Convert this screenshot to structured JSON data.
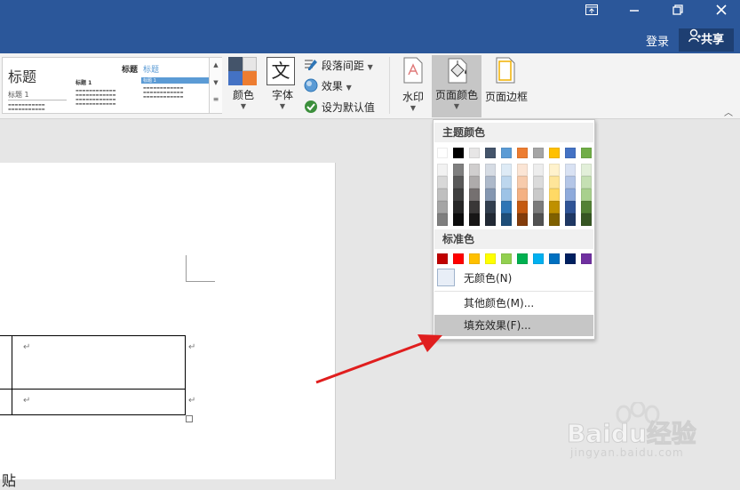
{
  "titlebar": {
    "buttons": [
      "ribbon-display-icon",
      "minimize-icon",
      "restore-icon",
      "close-icon"
    ],
    "login": "登录",
    "share": "共享"
  },
  "ribbon": {
    "gallery": {
      "items": [
        {
          "title": "标题",
          "heading": "标题 1"
        },
        {
          "title": "标题",
          "heading": "标题 1"
        },
        {
          "title": "标题",
          "heading": "标题 1"
        }
      ]
    },
    "colors": "颜色",
    "fonts": "字体",
    "font_glyph": "文",
    "paragraph_spacing": "段落间距",
    "effects": "效果",
    "set_default": "设为默认值",
    "watermark": "水印",
    "page_color": "页面颜色",
    "page_borders": "页面边框"
  },
  "document": {
    "cut_text": "贴"
  },
  "dropdown": {
    "theme_colors_header": "主题颜色",
    "theme_top_row": [
      "#ffffff",
      "#000000",
      "#e7e6e6",
      "#44546a",
      "#5b9bd5",
      "#ed7d31",
      "#a5a5a5",
      "#ffc000",
      "#4472c4",
      "#70ad47"
    ],
    "theme_shades": [
      [
        "#f2f2f2",
        "#7f7f7f",
        "#d0cece",
        "#d6dce4",
        "#deebf6",
        "#fbe5d5",
        "#ededed",
        "#fff2cc",
        "#d9e2f3",
        "#e2efd9"
      ],
      [
        "#d8d8d8",
        "#595959",
        "#aeabab",
        "#adb9ca",
        "#bdd7ee",
        "#f7cbac",
        "#dbdbdb",
        "#fee599",
        "#b4c6e7",
        "#c5e0b3"
      ],
      [
        "#bfbfbf",
        "#3f3f3f",
        "#757070",
        "#8496b0",
        "#9dc3e6",
        "#f4b183",
        "#c9c9c9",
        "#ffd965",
        "#8eaadb",
        "#a8d08d"
      ],
      [
        "#a5a5a5",
        "#262626",
        "#3a3838",
        "#323f4f",
        "#2e75b5",
        "#c55a11",
        "#7b7b7b",
        "#bf9000",
        "#2f5496",
        "#538135"
      ],
      [
        "#7f7f7f",
        "#0c0c0c",
        "#171616",
        "#222a35",
        "#1e4e79",
        "#833c0b",
        "#525252",
        "#7f6000",
        "#1f3864",
        "#375623"
      ]
    ],
    "standard_colors_header": "标准色",
    "standard_colors": [
      "#c00000",
      "#ff0000",
      "#ffc000",
      "#ffff00",
      "#92d050",
      "#00b050",
      "#00b0f0",
      "#0070c0",
      "#002060",
      "#7030a0"
    ],
    "no_color": "无颜色(N)",
    "more_colors": "其他颜色(M)...",
    "fill_effects": "填充效果(F)..."
  },
  "watermark": {
    "brand": "Baidu经验",
    "url": "jingyan.baidu.com"
  },
  "colors": {
    "titlebar": "#2b579a",
    "highlight": "#c6c6c6",
    "annotation_arrow": "#e01e1e"
  }
}
